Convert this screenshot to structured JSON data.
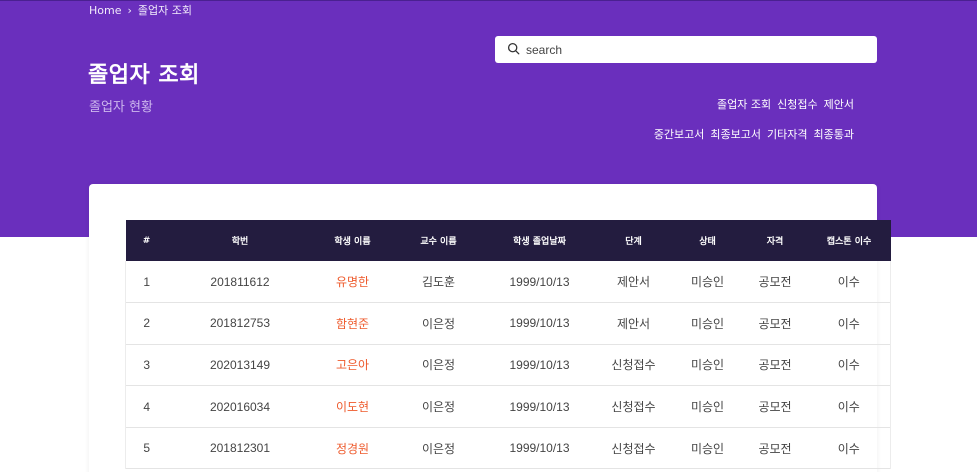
{
  "breadcrumb": {
    "home": "Home",
    "separator": "›",
    "current": "졸업자 조회"
  },
  "header": {
    "title": "졸업자 조회",
    "subtitle": "졸업자 현황"
  },
  "search": {
    "placeholder": "search",
    "value": ""
  },
  "nav": {
    "row1": [
      "졸업자 조회",
      "신청접수",
      "제안서"
    ],
    "row2": [
      "중간보고서",
      "최종보고서",
      "기타자격",
      "최종통과"
    ]
  },
  "table": {
    "headers": [
      "#",
      "학번",
      "학생 이름",
      "교수 이름",
      "학생 졸업날짜",
      "단계",
      "상태",
      "자격",
      "캡스톤 이수"
    ],
    "rows": [
      [
        "1",
        "201811612",
        "유명한",
        "김도훈",
        "1999/10/13",
        "제안서",
        "미승인",
        "공모전",
        "이수"
      ],
      [
        "2",
        "201812753",
        "함현준",
        "이은정",
        "1999/10/13",
        "제안서",
        "미승인",
        "공모전",
        "이수"
      ],
      [
        "3",
        "202013149",
        "고은아",
        "이은정",
        "1999/10/13",
        "신청접수",
        "미승인",
        "공모전",
        "이수"
      ],
      [
        "4",
        "202016034",
        "이도현",
        "이은정",
        "1999/10/13",
        "신청접수",
        "미승인",
        "공모전",
        "이수"
      ],
      [
        "5",
        "201812301",
        "정경원",
        "이은정",
        "1999/10/13",
        "신청접수",
        "미승인",
        "공모전",
        "이수"
      ]
    ]
  },
  "colors": {
    "hero": "#6a2fbd",
    "table_header": "#231c3f",
    "student_name": "#ee5a2c"
  },
  "icons": {
    "search": "search-icon",
    "breadcrumb_separator": "chevron-right-icon"
  }
}
